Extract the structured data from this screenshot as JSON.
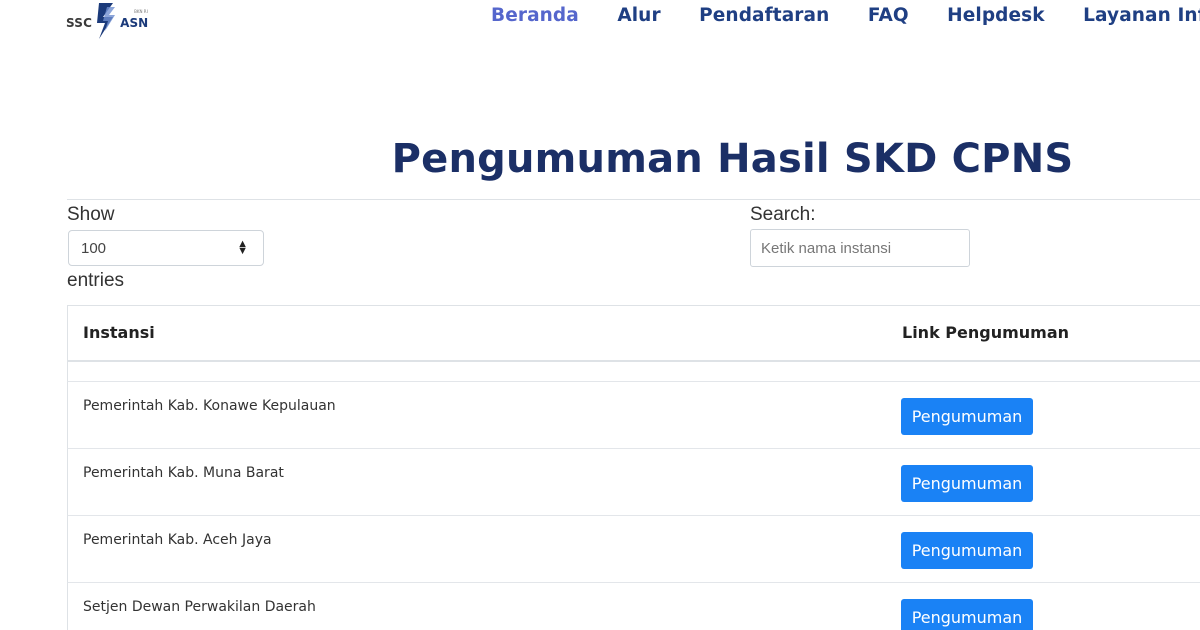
{
  "nav": {
    "logo": {
      "left_text": "SSC",
      "right_text": "ASN",
      "tiny_text": "BKN RI"
    },
    "links": [
      {
        "label": "Beranda",
        "active": true
      },
      {
        "label": "Alur",
        "active": false
      },
      {
        "label": "Pendaftaran",
        "active": false
      },
      {
        "label": "FAQ",
        "active": false
      },
      {
        "label": "Helpdesk",
        "active": false
      },
      {
        "label": "Layanan Infor",
        "active": false
      }
    ]
  },
  "page": {
    "title": "Pengumuman Hasil SKD CPNS"
  },
  "controls": {
    "show_label": "Show",
    "entries_label": "entries",
    "length_value": "100",
    "search_label": "Search:",
    "search_placeholder": "Ketik nama instansi",
    "search_value": ""
  },
  "table": {
    "headers": {
      "instansi": "Instansi",
      "link": "Link Pengumuman"
    },
    "rows": [
      {
        "instansi": "Pemerintah Kab. Konawe Kepulauan",
        "button": "Pengumuman"
      },
      {
        "instansi": "Pemerintah Kab. Muna Barat",
        "button": "Pengumuman"
      },
      {
        "instansi": "Pemerintah Kab. Aceh Jaya",
        "button": "Pengumuman"
      },
      {
        "instansi": "Setjen Dewan Perwakilan Daerah",
        "button": "Pengumuman"
      }
    ]
  },
  "colors": {
    "nav_text": "#1f3f83",
    "nav_active": "#5566cc",
    "title": "#1b2f66",
    "button_bg": "#1a82f5"
  },
  "icons": {
    "logo": "ssc-asn-logo-icon",
    "select_arrows": "updown-icon"
  }
}
